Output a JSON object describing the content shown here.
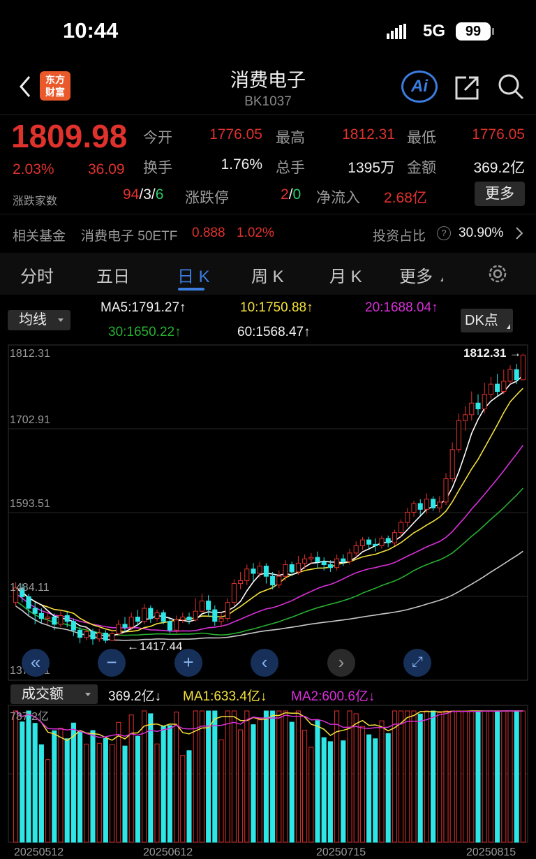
{
  "status": {
    "time": "10:44",
    "network": "5G",
    "battery": "99"
  },
  "header": {
    "title": "消费电子",
    "code": "BK1037",
    "logo_line1": "东方",
    "logo_line2": "财富",
    "ai_label": "Ai"
  },
  "quote": {
    "price": "1809.98",
    "change_pct": "2.03%",
    "change": "36.09",
    "open_label": "今开",
    "open": "1776.05",
    "high_label": "最高",
    "high": "1812.31",
    "low_label": "最低",
    "low": "1776.05",
    "turnover_label": "换手",
    "turnover": "1.76%",
    "volume_label": "总手",
    "volume": "1395万",
    "amount_label": "金额",
    "amount": "369.2亿",
    "breadth_label": "涨跌家数",
    "up_count": "94",
    "flat_count": "3",
    "down_count": "6",
    "limit_label": "涨跌停",
    "limit_up": "2",
    "limit_down": "0",
    "netflow_label": "净流入",
    "netflow": "2.68亿",
    "more_label": "更多"
  },
  "fund": {
    "label": "相关基金",
    "name": "消费电子 50ETF",
    "price": "0.888",
    "pct": "1.02%",
    "ratio_label": "投资占比",
    "ratio": "30.90%"
  },
  "tabs": [
    "分时",
    "五日",
    "日 K",
    "周 K",
    "月 K",
    "更多"
  ],
  "active_tab": 2,
  "indicators": {
    "selector": "均线",
    "ma5": "MA5:1791.27↑",
    "ma10": "10:1750.88↑",
    "ma20": "20:1688.04↑",
    "ma30": "30:1650.22↑",
    "ma60": "60:1568.47↑",
    "dk_label": "DK点"
  },
  "price_axis": [
    "1812.31",
    "1702.91",
    "1593.51",
    "1484.11",
    "1374.71"
  ],
  "annotations": {
    "high": "1812.31",
    "low": "1417.44"
  },
  "volume_panel": {
    "selector": "成交额",
    "value": "369.2亿↓",
    "ma1": "MA1:633.4亿↓",
    "ma2": "MA2:600.6亿↓",
    "axis_max": "787.2亿"
  },
  "dates": [
    "20250512",
    "20250612",
    "20250715",
    "20250815"
  ],
  "colors": {
    "up": "#e0322d",
    "down": "#2ee6e6",
    "ma5": "#ffffff",
    "ma10": "#f5e13c",
    "ma20": "#d930d9",
    "ma30": "#28b030",
    "ma60": "#c8c8c8",
    "accent": "#3b7de0"
  },
  "chart_data": {
    "type": "candlestick",
    "ylim": [
      1374.71,
      1812.31
    ],
    "candles": [
      [
        1470,
        1490,
        1465,
        1498
      ],
      [
        1490,
        1478,
        1470,
        1496
      ],
      [
        1478,
        1462,
        1452,
        1482
      ],
      [
        1462,
        1455,
        1440,
        1470
      ],
      [
        1455,
        1448,
        1442,
        1462
      ],
      [
        1448,
        1450,
        1440,
        1458
      ],
      [
        1450,
        1440,
        1432,
        1455
      ],
      [
        1440,
        1452,
        1436,
        1458
      ],
      [
        1452,
        1444,
        1436,
        1457
      ],
      [
        1444,
        1432,
        1424,
        1448
      ],
      [
        1432,
        1422,
        1414,
        1436
      ],
      [
        1422,
        1430,
        1418,
        1436
      ],
      [
        1430,
        1420,
        1412,
        1434
      ],
      [
        1420,
        1428,
        1416,
        1434
      ],
      [
        1428,
        1418,
        1414,
        1432
      ],
      [
        1418,
        1427,
        1417,
        1433
      ],
      [
        1427,
        1440,
        1424,
        1446
      ],
      [
        1440,
        1436,
        1430,
        1450
      ],
      [
        1436,
        1450,
        1432,
        1456
      ],
      [
        1450,
        1444,
        1438,
        1460
      ],
      [
        1444,
        1462,
        1440,
        1468
      ],
      [
        1462,
        1448,
        1442,
        1466
      ],
      [
        1448,
        1456,
        1444,
        1460
      ],
      [
        1456,
        1444,
        1440,
        1460
      ],
      [
        1444,
        1432,
        1428,
        1448
      ],
      [
        1432,
        1446,
        1428,
        1452
      ],
      [
        1446,
        1450,
        1442,
        1456
      ],
      [
        1450,
        1446,
        1440,
        1456
      ],
      [
        1446,
        1458,
        1444,
        1476
      ],
      [
        1458,
        1472,
        1456,
        1482
      ],
      [
        1472,
        1460,
        1450,
        1480
      ],
      [
        1460,
        1444,
        1438,
        1466
      ],
      [
        1444,
        1448,
        1436,
        1456
      ],
      [
        1448,
        1470,
        1444,
        1476
      ],
      [
        1470,
        1496,
        1466,
        1502
      ],
      [
        1496,
        1500,
        1488,
        1512
      ],
      [
        1500,
        1516,
        1494,
        1522
      ],
      [
        1516,
        1510,
        1500,
        1524
      ],
      [
        1510,
        1520,
        1504,
        1526
      ],
      [
        1520,
        1506,
        1496,
        1524
      ],
      [
        1506,
        1494,
        1488,
        1512
      ],
      [
        1494,
        1506,
        1490,
        1514
      ],
      [
        1506,
        1522,
        1500,
        1528
      ],
      [
        1522,
        1512,
        1506,
        1526
      ],
      [
        1512,
        1524,
        1508,
        1534
      ],
      [
        1524,
        1530,
        1516,
        1536
      ],
      [
        1530,
        1532,
        1522,
        1538
      ],
      [
        1532,
        1526,
        1516,
        1540
      ],
      [
        1526,
        1522,
        1514,
        1532
      ],
      [
        1522,
        1518,
        1512,
        1528
      ],
      [
        1518,
        1530,
        1514,
        1536
      ],
      [
        1530,
        1526,
        1520,
        1536
      ],
      [
        1526,
        1538,
        1522,
        1544
      ],
      [
        1538,
        1548,
        1532,
        1554
      ],
      [
        1548,
        1556,
        1542,
        1560
      ],
      [
        1556,
        1550,
        1544,
        1560
      ],
      [
        1550,
        1548,
        1540,
        1558
      ],
      [
        1548,
        1558,
        1544,
        1562
      ],
      [
        1558,
        1552,
        1546,
        1562
      ],
      [
        1552,
        1566,
        1548,
        1570
      ],
      [
        1566,
        1580,
        1560,
        1584
      ],
      [
        1580,
        1594,
        1574,
        1600
      ],
      [
        1594,
        1606,
        1588,
        1610
      ],
      [
        1606,
        1598,
        1590,
        1612
      ],
      [
        1598,
        1612,
        1592,
        1620
      ],
      [
        1612,
        1600,
        1596,
        1616
      ],
      [
        1600,
        1608,
        1594,
        1616
      ],
      [
        1608,
        1640,
        1604,
        1648
      ],
      [
        1640,
        1680,
        1636,
        1690
      ],
      [
        1680,
        1720,
        1676,
        1730
      ],
      [
        1720,
        1728,
        1706,
        1740
      ],
      [
        1728,
        1744,
        1720,
        1760
      ],
      [
        1744,
        1736,
        1728,
        1756
      ],
      [
        1736,
        1756,
        1730,
        1772
      ],
      [
        1756,
        1770,
        1750,
        1780
      ],
      [
        1770,
        1760,
        1754,
        1784
      ],
      [
        1760,
        1774,
        1756,
        1790
      ],
      [
        1774,
        1790,
        1770,
        1796
      ],
      [
        1790,
        1776,
        1770,
        1798
      ],
      [
        1776,
        1810,
        1776,
        1812
      ]
    ]
  }
}
